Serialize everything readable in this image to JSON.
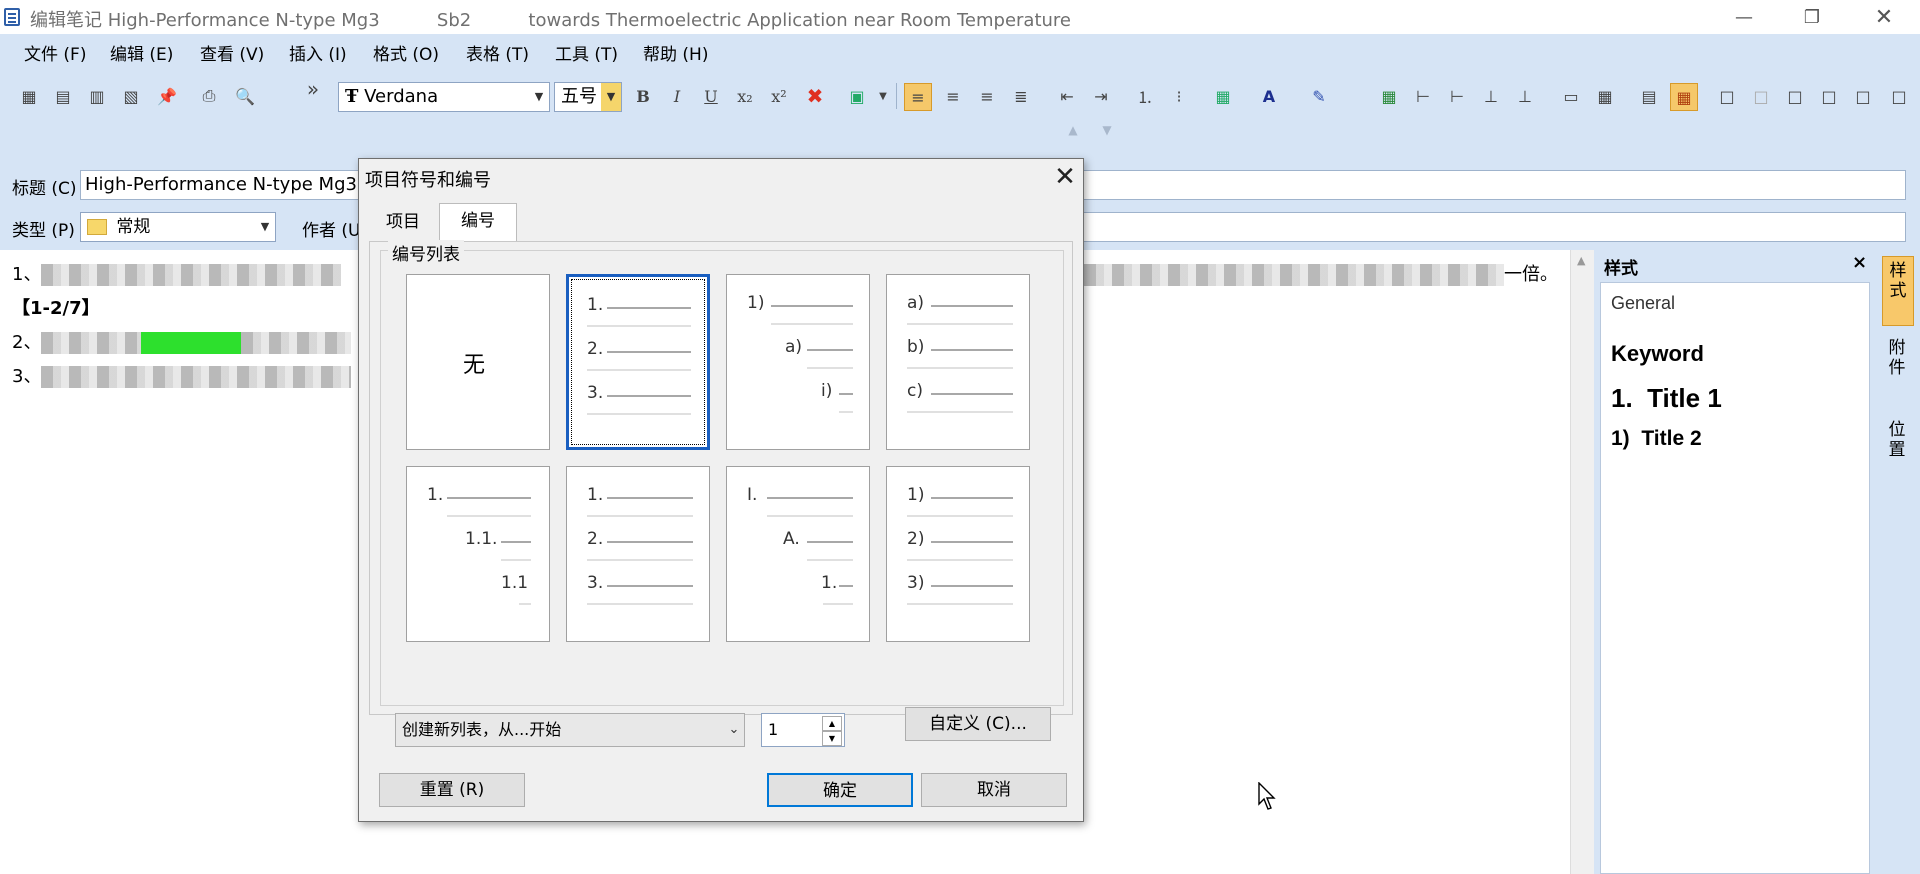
{
  "window": {
    "title": "编辑笔记 High-Performance N-type Mg3          Sb2          towards Thermoelectric Application near Room Temperature",
    "buttons": {
      "minimize": "—",
      "restore": "❐",
      "close": "✕"
    }
  },
  "menubar": [
    "文件 (F)",
    "编辑 (E)",
    "查看 (V)",
    "插入 (I)",
    "格式 (O)",
    "表格 (T)",
    "工具 (T)",
    "帮助 (H)"
  ],
  "toolbar": {
    "font_name": "Verdana",
    "font_size": "五号",
    "overflow": "»",
    "format_buttons": {
      "bold": "B",
      "italic": "I",
      "underline": "U",
      "subscript": "x₂",
      "superscript": "x²",
      "clear": "✖"
    },
    "font_color_letter": "A"
  },
  "fields": {
    "title_label": "标题 (C)",
    "title_value": "High-Performance N-type Mg3",
    "type_label": "类型 (P)",
    "type_value": "常规",
    "author_label": "作者 (U"
  },
  "editor": {
    "lines": [
      "1、",
      "【1-2/7】",
      "2、",
      "3、"
    ],
    "line1_tail": "一倍。"
  },
  "style_pane": {
    "header": "样式",
    "close": "×",
    "items": [
      "General",
      "Keyword",
      "1.  Title 1",
      "1)  Title 2"
    ]
  },
  "side_tabs": [
    "样式",
    "附件",
    "位置"
  ],
  "dialog": {
    "title": "项目符号和编号",
    "close": "✕",
    "tabs": [
      "项目",
      "编号"
    ],
    "active_tab": 1,
    "group_label": "编号列表",
    "none_label": "无",
    "styles": [
      {
        "labels": []
      },
      {
        "labels": [
          "1.",
          "2.",
          "3."
        ]
      },
      {
        "labels": [
          "1)",
          "a)",
          "i)"
        ]
      },
      {
        "labels": [
          "a)",
          "b)",
          "c)"
        ]
      },
      {
        "labels": [
          "1.",
          "1.1.",
          "1.1"
        ]
      },
      {
        "labels": [
          "1.",
          "2.",
          "3."
        ]
      },
      {
        "labels": [
          "I.",
          "A.",
          "1."
        ]
      },
      {
        "labels": [
          "1)",
          "2)",
          "3)"
        ]
      }
    ],
    "selected_style": 1,
    "list_mode": "创建新列表，从...开始",
    "start_value": "1",
    "customize": "自定义 (C)...",
    "reset": "重置 (R)",
    "ok": "确定",
    "cancel": "取消"
  }
}
